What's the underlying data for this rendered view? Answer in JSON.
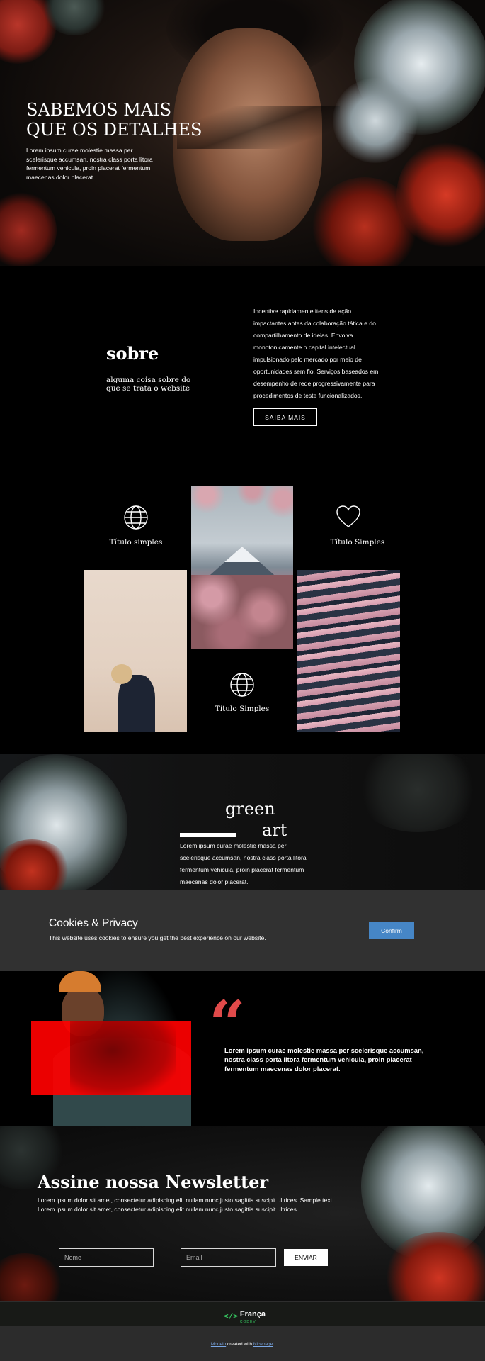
{
  "hero": {
    "title": "SABEMOS MAIS QUE OS DETALHES",
    "text": "Lorem ipsum curae molestie massa per scelerisque accumsan, nostra class porta litora fermentum vehicula, proin placerat fermentum maecenas dolor placerat."
  },
  "about": {
    "title": "sobre",
    "subtitle": "alguma coisa sobre do que se trata  o website",
    "text": "Incentive rapidamente itens de ação impactantes antes da colaboração tática e do compartilhamento de ideias. Envolva monotonicamente o capital intelectual impulsionado pelo mercado por meio de oportunidades sem fio. Serviços baseados em desempenho de rede progressivamente para procedimentos de teste funcionalizados.",
    "button": "SAIBA MAIS"
  },
  "gallery": {
    "items": [
      {
        "label": "Título simples",
        "icon": "globe-icon"
      },
      {
        "label": "Título Simples",
        "icon": "heart-icon"
      },
      {
        "label": "Título Simples",
        "icon": "globe-icon"
      }
    ]
  },
  "green": {
    "title_line1": "green",
    "title_line2": "art",
    "text": "Lorem ipsum curae molestie massa per scelerisque accumsan, nostra class porta litora fermentum vehicula, proin placerat fermentum maecenas dolor placerat."
  },
  "cookies": {
    "title": "Cookies & Privacy",
    "text": "This website uses cookies to ensure you get the best experience on our website.",
    "button": "Confirm",
    "button_color": "#4686c6"
  },
  "testimonial": {
    "quote_mark": "“",
    "text": "Lorem ipsum curae molestie massa per scelerisque accumsan, nostra class porta litora fermentum vehicula, proin placerat fermentum maecenas dolor placerat.",
    "accent_color": "#e04a4a"
  },
  "newsletter": {
    "title": "Assine nossa Newsletter",
    "text": "Lorem ipsum dolor sit amet, consectetur adipiscing elit nullam nunc justo sagittis suscipit ultrices. Sample text. Lorem ipsum dolor sit amet, consectetur adipiscing elit nullam nunc justo sagittis suscipit ultrices.",
    "name_placeholder": "Nome",
    "email_placeholder": "Email",
    "button": "ENVIAR"
  },
  "brand": {
    "code_symbol": "</>",
    "name": "França",
    "sub": "CODEV"
  },
  "footer": {
    "link1": "Modelo",
    "middle": " created with ",
    "link2": "Nicepage",
    "end": "."
  }
}
